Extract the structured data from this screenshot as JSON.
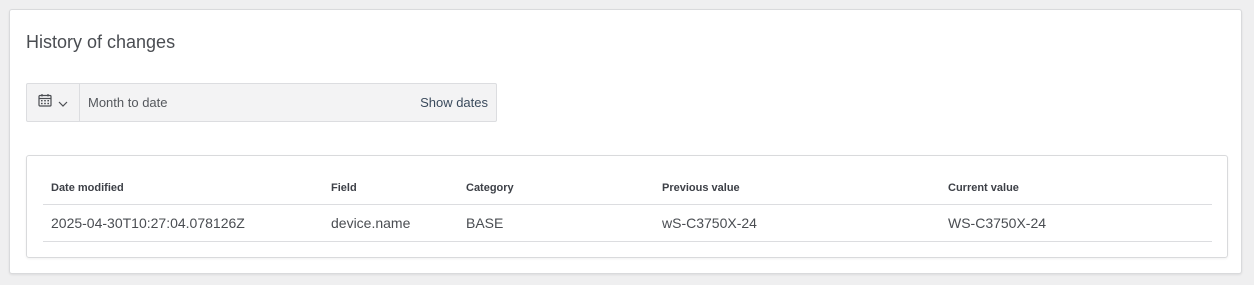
{
  "page": {
    "title": "History of changes"
  },
  "date_filter": {
    "calendar_icon": "calendar-icon",
    "chevron_icon": "chevron-down-icon",
    "range_label": "Month to date",
    "show_dates_label": "Show dates"
  },
  "table": {
    "columns": [
      "Date modified",
      "Field",
      "Category",
      "Previous value",
      "Current value"
    ],
    "rows": [
      {
        "date_modified": "2025-04-30T10:27:04.078126Z",
        "field": "device.name",
        "category": "BASE",
        "previous_value": "wS-C3750X-24",
        "current_value": "WS-C3750X-24"
      }
    ]
  },
  "colors": {
    "page_background": "#efeff0",
    "card_background": "#ffffff",
    "border": "#d9dadc",
    "text": "#4a4d52"
  }
}
